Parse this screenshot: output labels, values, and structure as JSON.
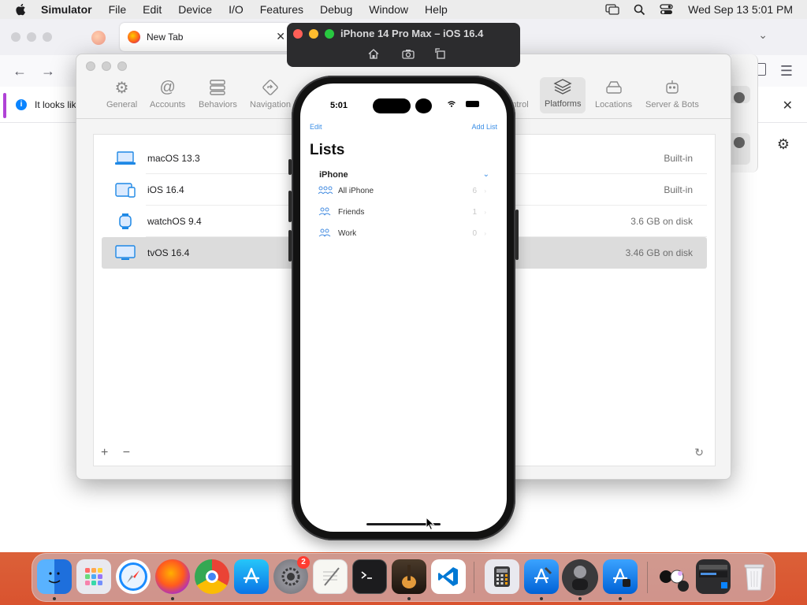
{
  "menubar": {
    "app": "Simulator",
    "items": [
      "File",
      "Edit",
      "Device",
      "I/O",
      "Features",
      "Debug",
      "Window",
      "Help"
    ],
    "clock": "Wed Sep 13  5:01 PM"
  },
  "browser": {
    "tab_title": "New Tab",
    "notice": "It looks lik"
  },
  "settings": {
    "window_title": "Platforms",
    "toolbar": [
      {
        "label": "General",
        "icon": "gear-icon"
      },
      {
        "label": "Accounts",
        "icon": "at-icon"
      },
      {
        "label": "Behaviors",
        "icon": "behaviors-icon"
      },
      {
        "label": "Navigation",
        "icon": "navigation-icon"
      },
      {
        "label": "ntrol",
        "icon": "source-control-icon"
      },
      {
        "label": "Platforms",
        "icon": "layers-icon"
      },
      {
        "label": "Locations",
        "icon": "drive-icon"
      },
      {
        "label": "Server & Bots",
        "icon": "robot-icon"
      }
    ],
    "platforms": [
      {
        "name": "macOS 13.3",
        "status": "Built-in",
        "icon": "laptop-icon"
      },
      {
        "name": "iOS 16.4",
        "status": "Built-in",
        "icon": "ipad-iphone-icon"
      },
      {
        "name": "watchOS 9.4",
        "status": "3.6 GB on disk",
        "icon": "watch-icon"
      },
      {
        "name": "tvOS 16.4",
        "status": "3.46 GB on disk",
        "icon": "tv-icon"
      }
    ],
    "plus": "+",
    "minus": "−"
  },
  "simulator": {
    "title": "iPhone 14 Pro Max – iOS 16.4"
  },
  "phone": {
    "time": "5:01",
    "edit": "Edit",
    "add_list": "Add List",
    "title": "Lists",
    "section": "iPhone",
    "items": [
      {
        "label": "All iPhone",
        "count": "6"
      },
      {
        "label": "Friends",
        "count": "1"
      },
      {
        "label": "Work",
        "count": "0"
      }
    ]
  },
  "dock": {
    "settings_badge": "2"
  },
  "colors": {
    "accent_blue": "#3a8ee6",
    "selection_gray": "#dcdcdc",
    "close_red": "#ff5f57",
    "minimize_yellow": "#febc2e",
    "zoom_green": "#28c840"
  }
}
